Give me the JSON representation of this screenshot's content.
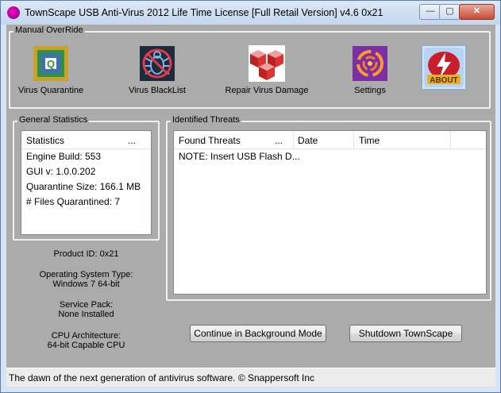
{
  "window": {
    "title": "TownScape USB Anti-Virus 2012 Life Time License [Full Retail Version] v4.6 0x21",
    "minimize": "—",
    "maximize": "▢",
    "close": "✕"
  },
  "manual_override": {
    "label": "Manual OverRide",
    "tools": [
      {
        "label": "Virus Quarantine",
        "icon": "quarantine-icon"
      },
      {
        "label": "Virus BlackList",
        "icon": "bug-icon"
      },
      {
        "label": "Repair Virus Damage",
        "icon": "cubes-icon"
      },
      {
        "label": "Settings",
        "icon": "swirl-icon"
      },
      {
        "label": "ABOUT",
        "icon": "about-icon"
      }
    ]
  },
  "general_statistics": {
    "label": "General Statistics",
    "header": "Statistics",
    "header_more": "...",
    "rows": [
      "Engine Build: 553",
      "GUI v: 1.0.0.202",
      "Quarantine Size: 166.1 MB",
      "# Files Quarantined: 7"
    ]
  },
  "identified_threats": {
    "label": "Identified Threats",
    "columns": [
      "Found Threats",
      "...",
      "Date",
      "Time"
    ],
    "rows": [
      {
        "found": "NOTE: Insert USB Flash D...",
        "date": "",
        "time": ""
      }
    ]
  },
  "system_info": {
    "product_id": "Product ID: 0x21",
    "os_label": "Operating System Type:",
    "os_value": "Windows 7 64-bit",
    "sp_label": "Service Pack:",
    "sp_value": "None Installed",
    "cpu_label": "CPU Architecture:",
    "cpu_value": "64-bit Capable CPU"
  },
  "buttons": {
    "background": "Continue in Background Mode",
    "shutdown": "Shutdown TownScape"
  },
  "status_bar": "The dawn of the next generation of antivirus software. © Snappersoft Inc"
}
